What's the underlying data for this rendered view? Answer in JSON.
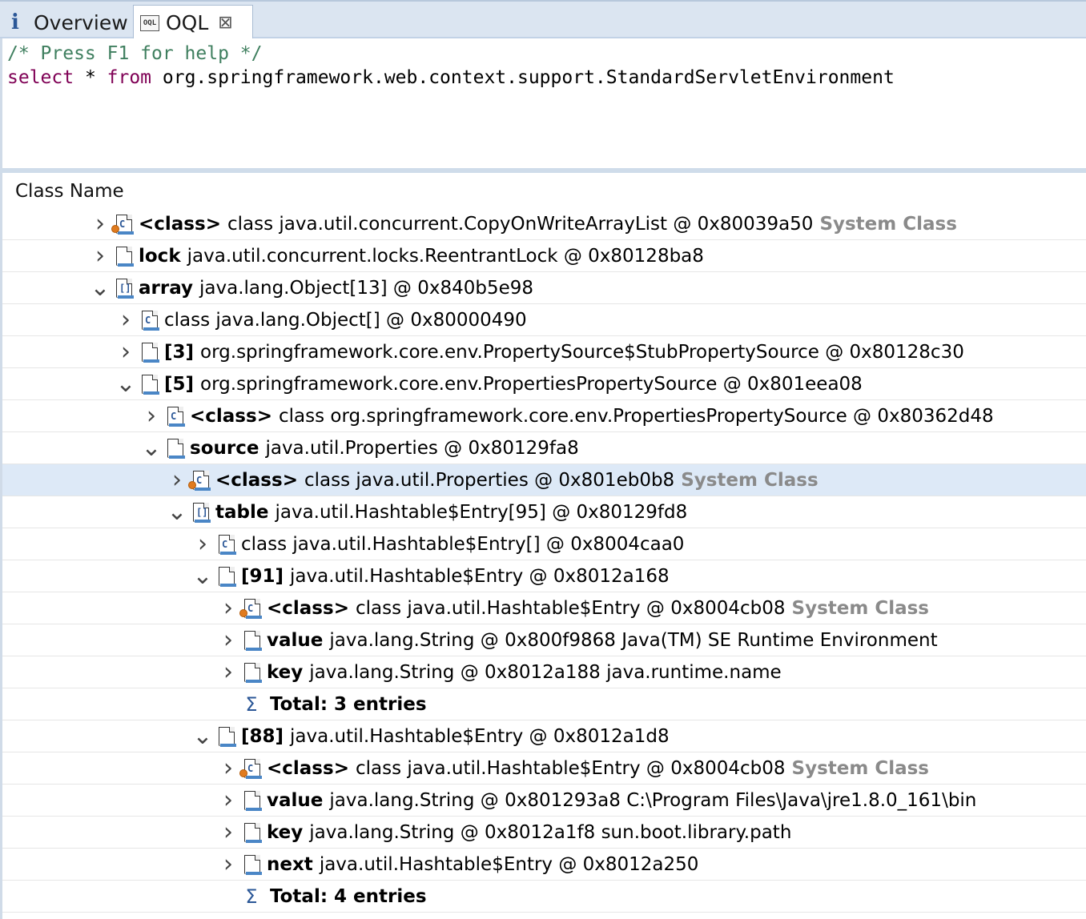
{
  "tabs": [
    {
      "label": "Overview",
      "icon": "info-icon"
    },
    {
      "label": "OQL",
      "icon": "oql-icon",
      "closable": true
    }
  ],
  "editor": {
    "line1": "/* Press F1 for help */",
    "line2_kw1": "select",
    "line2_star": " * ",
    "line2_kw2": "from",
    "line2_rest": " org.springframework.web.context.support.StandardServletEnvironment"
  },
  "results": {
    "column_header": "Class Name",
    "rows": [
      {
        "twisty": ">",
        "icon": "system-class-icon",
        "name": "<class>",
        "text": "class java.util.concurrent.CopyOnWriteArrayList @ 0x80039a50",
        "extra": "System Class"
      },
      {
        "twisty": ">",
        "icon": "object-icon",
        "name": "lock",
        "text": "java.util.concurrent.locks.ReentrantLock @ 0x80128ba8",
        "extra": ""
      },
      {
        "twisty": "v",
        "icon": "array-icon",
        "name": "array",
        "text": "java.lang.Object[13] @ 0x840b5e98",
        "extra": ""
      },
      {
        "twisty": ">",
        "icon": "class-icon",
        "name": "",
        "text": "class java.lang.Object[] @ 0x80000490",
        "extra": ""
      },
      {
        "twisty": ">",
        "icon": "object-icon",
        "name": "[3]",
        "text": "org.springframework.core.env.PropertySource$StubPropertySource @ 0x80128c30",
        "extra": ""
      },
      {
        "twisty": "v",
        "icon": "object-icon",
        "name": "[5]",
        "text": "org.springframework.core.env.PropertiesPropertySource @ 0x801eea08",
        "extra": ""
      },
      {
        "twisty": ">",
        "icon": "class-icon",
        "name": "<class>",
        "text": "class org.springframework.core.env.PropertiesPropertySource @ 0x80362d48",
        "extra": ""
      },
      {
        "twisty": "v",
        "icon": "object-icon",
        "name": "source",
        "text": "java.util.Properties @ 0x80129fa8",
        "extra": ""
      },
      {
        "twisty": ">",
        "icon": "system-class-icon",
        "name": "<class>",
        "text": "class java.util.Properties @ 0x801eb0b8",
        "extra": "System Class",
        "selected": true
      },
      {
        "twisty": "v",
        "icon": "array-icon",
        "name": "table",
        "text": "java.util.Hashtable$Entry[95] @ 0x80129fd8",
        "extra": ""
      },
      {
        "twisty": ">",
        "icon": "class-icon",
        "name": "",
        "text": "class java.util.Hashtable$Entry[] @ 0x8004caa0",
        "extra": ""
      },
      {
        "twisty": "v",
        "icon": "object-icon",
        "name": "[91]",
        "text": "java.util.Hashtable$Entry @ 0x8012a168",
        "extra": ""
      },
      {
        "twisty": ">",
        "icon": "system-class-icon",
        "name": "<class>",
        "text": "class java.util.Hashtable$Entry @ 0x8004cb08",
        "extra": "System Class"
      },
      {
        "twisty": ">",
        "icon": "object-icon",
        "name": "value",
        "text": "java.lang.String @ 0x800f9868  Java(TM) SE Runtime Environment",
        "extra": ""
      },
      {
        "twisty": ">",
        "icon": "object-icon",
        "name": "key",
        "text": "java.lang.String @ 0x8012a188  java.runtime.name",
        "extra": ""
      },
      {
        "twisty": "",
        "icon": "sum-icon",
        "name": "Total: 3 entries",
        "text": "",
        "extra": ""
      },
      {
        "twisty": "v",
        "icon": "object-icon",
        "name": "[88]",
        "text": "java.util.Hashtable$Entry @ 0x8012a1d8",
        "extra": ""
      },
      {
        "twisty": ">",
        "icon": "system-class-icon",
        "name": "<class>",
        "text": "class java.util.Hashtable$Entry @ 0x8004cb08",
        "extra": "System Class"
      },
      {
        "twisty": ">",
        "icon": "object-icon",
        "name": "value",
        "text": "java.lang.String @ 0x801293a8  C:\\Program Files\\Java\\jre1.8.0_161\\bin",
        "extra": ""
      },
      {
        "twisty": ">",
        "icon": "object-icon",
        "name": "key",
        "text": "java.lang.String @ 0x8012a1f8  sun.boot.library.path",
        "extra": ""
      },
      {
        "twisty": ">",
        "icon": "object-icon",
        "name": "next",
        "text": "java.util.Hashtable$Entry @ 0x8012a250",
        "extra": ""
      },
      {
        "twisty": "",
        "icon": "sum-icon",
        "name": "Total: 4 entries",
        "text": "",
        "extra": ""
      }
    ]
  }
}
